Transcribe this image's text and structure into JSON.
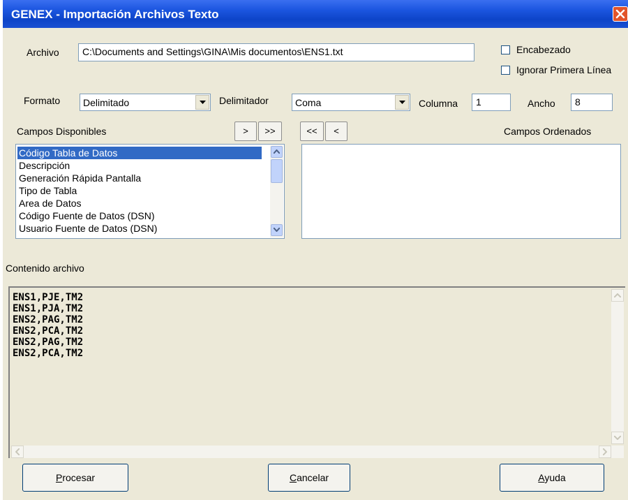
{
  "window": {
    "title": "GENEX - Importación Archivos Texto"
  },
  "archivo": {
    "label": "Archivo",
    "value": "C:\\Documents and Settings\\GINA\\Mis documentos\\ENS1.txt"
  },
  "options": {
    "encabezado": "Encabezado",
    "ignorar": "Ignorar Primera Línea"
  },
  "formato": {
    "label": "Formato",
    "value": "Delimitado"
  },
  "delimitador": {
    "label": "Delimitador",
    "value": "Coma"
  },
  "columna": {
    "label": "Columna",
    "value": "1"
  },
  "ancho": {
    "label": "Ancho",
    "value": "8"
  },
  "campos_disponibles": {
    "label": "Campos Disponibles",
    "items": [
      "Código Tabla de Datos",
      "Descripción",
      "Generación Rápida Pantalla",
      "Tipo de Tabla",
      "Area de Datos",
      "Código Fuente de Datos (DSN)",
      "Usuario Fuente de Datos (DSN)"
    ],
    "selected_index": 0
  },
  "move_buttons": {
    "add_one": ">",
    "add_all": ">>",
    "remove_all": "<<",
    "remove_one": "<"
  },
  "campos_ordenados": {
    "label": "Campos Ordenados"
  },
  "contenido": {
    "label": "Contenido archivo",
    "lines": [
      "ENS1,PJE,TM2",
      "ENS1,PJA,TM2",
      "ENS2,PAG,TM2",
      "ENS2,PCA,TM2",
      "ENS2,PAG,TM2",
      "ENS2,PCA,TM2"
    ]
  },
  "buttons": {
    "procesar": {
      "mnemonic": "P",
      "rest": "rocesar"
    },
    "cancelar": {
      "mnemonic": "C",
      "rest": "ancelar"
    },
    "ayuda": {
      "mnemonic": "A",
      "rest": "yuda"
    }
  },
  "icons": {
    "close": "close-icon",
    "dropdown": "chevron-down-icon",
    "scroll_up": "arrow-up-icon",
    "scroll_down": "arrow-down-icon"
  }
}
